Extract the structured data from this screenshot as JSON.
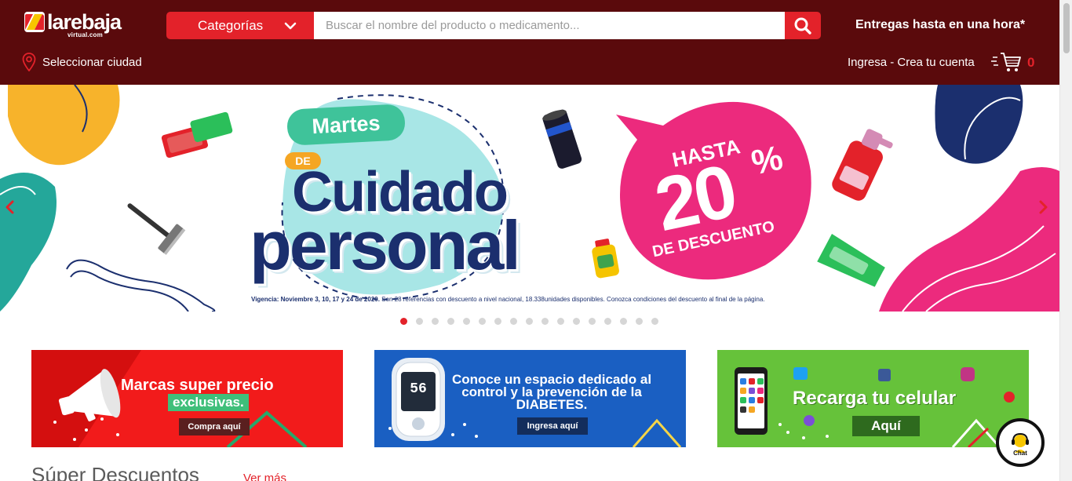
{
  "header": {
    "logo_text": "larebaja",
    "logo_sub": "virtual.com",
    "categories_label": "Categorías",
    "search_placeholder": "Buscar el nombre del producto o medicamento...",
    "delivery_text": "Entregas hasta en una hora*",
    "city_label": "Seleccionar ciudad",
    "account_label": "Ingresa - Crea tu cuenta",
    "cart_count": "0"
  },
  "banner": {
    "martes": "Martes",
    "de": "DE",
    "cuidado": "Cuidado",
    "personal": "personal",
    "hasta": "HASTA",
    "percent": "20",
    "percent_sign": "%",
    "descuento": "DE DESCUENTO",
    "vigencia_bold": "Vigencia: Noviembre 3, 10, 17 y 24 de 2020.",
    "vigencia_text": " Son 28 referencias con descuento a nivel nacional, 18.338unidades disponibles. Conozca condiciones del descuento al final de la página.",
    "slide_count": 17,
    "active_slide": 0
  },
  "promos": [
    {
      "title": "Marcas super precio",
      "subtitle": "exclusivas.",
      "button": "Compra aquí"
    },
    {
      "title": "Conoce un espacio dedicado al control y la prevención de la DIABETES.",
      "button": "Ingresa aquí",
      "meter_value": "56"
    },
    {
      "title": "Recarga tu celular",
      "button": "Aquí"
    }
  ],
  "section": {
    "title": "Súper Descuentos",
    "see_more": "Ver más"
  },
  "chat": {
    "label": "Chat"
  },
  "colors": {
    "header_bg": "#5a0a0c",
    "accent_red": "#e3222a",
    "navy": "#1b2f6e",
    "pink": "#ec2a7d",
    "teal": "#24a79a"
  }
}
